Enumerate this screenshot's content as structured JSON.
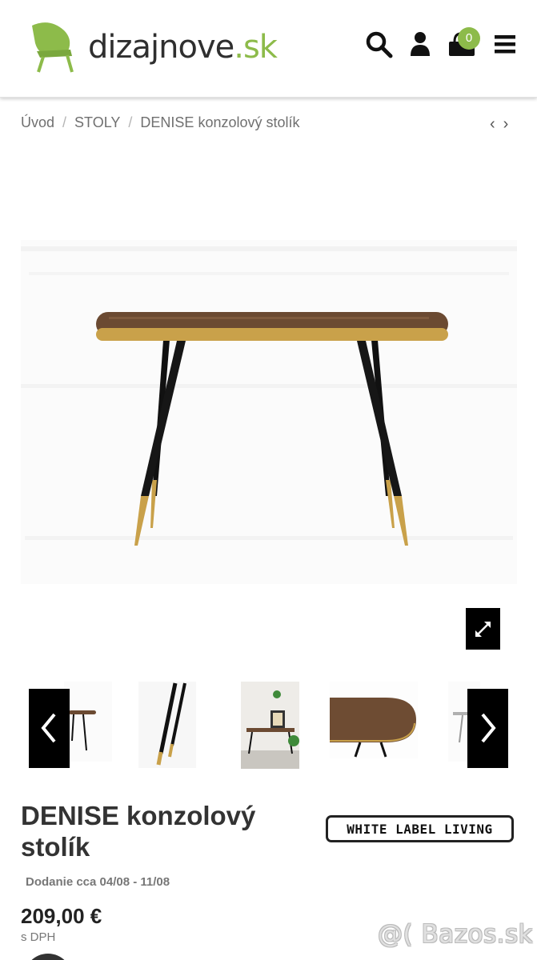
{
  "header": {
    "logo_text": "dizajnove",
    "logo_tld": ".sk",
    "cart_count": "0",
    "icons": [
      "search-icon",
      "user-icon",
      "cart-icon",
      "menu-icon"
    ],
    "brand_color": "#8dbb4a"
  },
  "breadcrumb": {
    "home": "Úvod",
    "category": "STOLY",
    "current": "DENISE konzolový stolík",
    "separator": "/",
    "prev": "‹",
    "next": "›"
  },
  "gallery": {
    "thumbnails": [
      "table-side-view",
      "table-legs",
      "table-room-scene",
      "table-top-detail",
      "table-alt-view"
    ]
  },
  "product": {
    "title": "DENISE konzolový stolík",
    "brand": "WHITE LABEL LIVING",
    "delivery": "Dodanie cca 04/08 - 11/08",
    "price": "209,00 €",
    "vat": "s DPH"
  },
  "watermark": "@( Bazos.sk"
}
